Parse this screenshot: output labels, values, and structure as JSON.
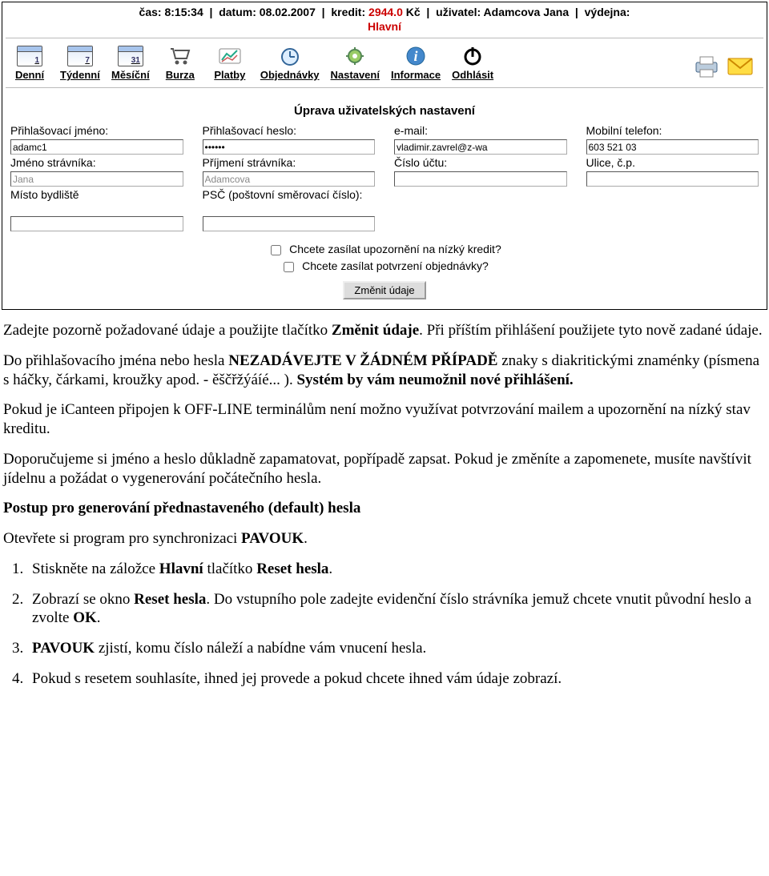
{
  "status": {
    "cas_label": "čas:",
    "cas_value": "8:15:34",
    "datum_label": "datum:",
    "datum_value": "08.02.2007",
    "kredit_label": "kredit:",
    "kredit_value": "2944.0",
    "kredit_unit": "Kč",
    "uzivatel_label": "uživatel:",
    "uzivatel_value": "Adamcova Jana",
    "vydejna_label": "výdejna:",
    "vydejna_value": "Hlavní"
  },
  "toolbar": {
    "denni": {
      "label": "Denní",
      "num": "1"
    },
    "tydenni": {
      "label": "Týdenní",
      "num": "7"
    },
    "mesicni": {
      "label": "Měsíční",
      "num": "31"
    },
    "burza": "Burza",
    "platby": "Platby",
    "objednavky": "Objednávky",
    "nastaveni": "Nastavení",
    "informace": "Informace",
    "odhlasit": "Odhlásit"
  },
  "form": {
    "title": "Úprava uživatelských nastavení",
    "fields": {
      "login_label": "Přihlašovací jméno:",
      "login_value": "adamc1",
      "pass_label": "Přihlašovací heslo:",
      "pass_value": "••••••",
      "email_label": "e-mail:",
      "email_value": "vladimir.zavrel@z-wa",
      "mobil_label": "Mobilní telefon:",
      "mobil_value": "603 521 03",
      "jmeno_label": "Jméno strávníka:",
      "jmeno_value": "Jana",
      "prijmeni_label": "Příjmení strávníka:",
      "prijmeni_value": "Adamcova",
      "ucet_label": "Číslo účtu:",
      "ucet_value": "",
      "ulice_label": "Ulice, č.p.",
      "ulice_value": "",
      "misto_label": "Místo bydliště",
      "misto_value": "",
      "psc_label": "PSČ (poštovní směrovací číslo):",
      "psc_value": ""
    },
    "checks": {
      "low_credit": "Chcete zasílat upozornění na nízký kredit?",
      "confirm_order": "Chcete zasílat potvrzení objednávky?"
    },
    "submit": "Změnit údaje"
  },
  "doc": {
    "p1a": "Zadejte pozorně požadované údaje a použijte tlačítko ",
    "p1b": "Změnit údaje",
    "p1c": ". Při příštím přihlášení použijete tyto nově zadané údaje.",
    "p2a": "Do přihlašovacího jména nebo hesla ",
    "p2b": "NEZADÁVEJTE V ŽÁDNÉM PŘÍPADĚ",
    "p2c": " znaky s diakritickými znaménky (písmena s háčky, čárkami, kroužky apod. - ěščřžýáíé... ). ",
    "p2d": "Systém by vám neumožnil nové přihlášení.",
    "p3": "Pokud je iCanteen připojen k OFF-LINE terminálům není možno využívat potvrzování mailem a upozornění na nízký stav kreditu.",
    "p4": "Doporučujeme si jméno a heslo důkladně zapamatovat, popřípadě zapsat. Pokud je změníte a zapomenete, musíte navštívit jídelnu a požádat o vygenerování počátečního hesla.",
    "h3": "Postup pro generování přednastaveného (default) hesla",
    "p5a": "Otevřete si program pro synchronizaci ",
    "p5b": "PAVOUK",
    "p5c": ".",
    "li1a": "Stiskněte na záložce ",
    "li1b": "Hlavní",
    "li1c": " tlačítko ",
    "li1d": "Reset hesla",
    "li1e": ".",
    "li2a": "Zobrazí se okno ",
    "li2b": "Reset hesla",
    "li2c": ". Do vstupního pole zadejte evidenční číslo strávníka jemuž chcete vnutit původní heslo a zvolte ",
    "li2d": "OK",
    "li2e": ".",
    "li3a": "PAVOUK",
    "li3b": " zjistí, komu číslo náleží a nabídne vám vnucení hesla.",
    "li4": "Pokud s resetem souhlasíte, ihned jej provede a pokud chcete ihned vám údaje zobrazí."
  }
}
